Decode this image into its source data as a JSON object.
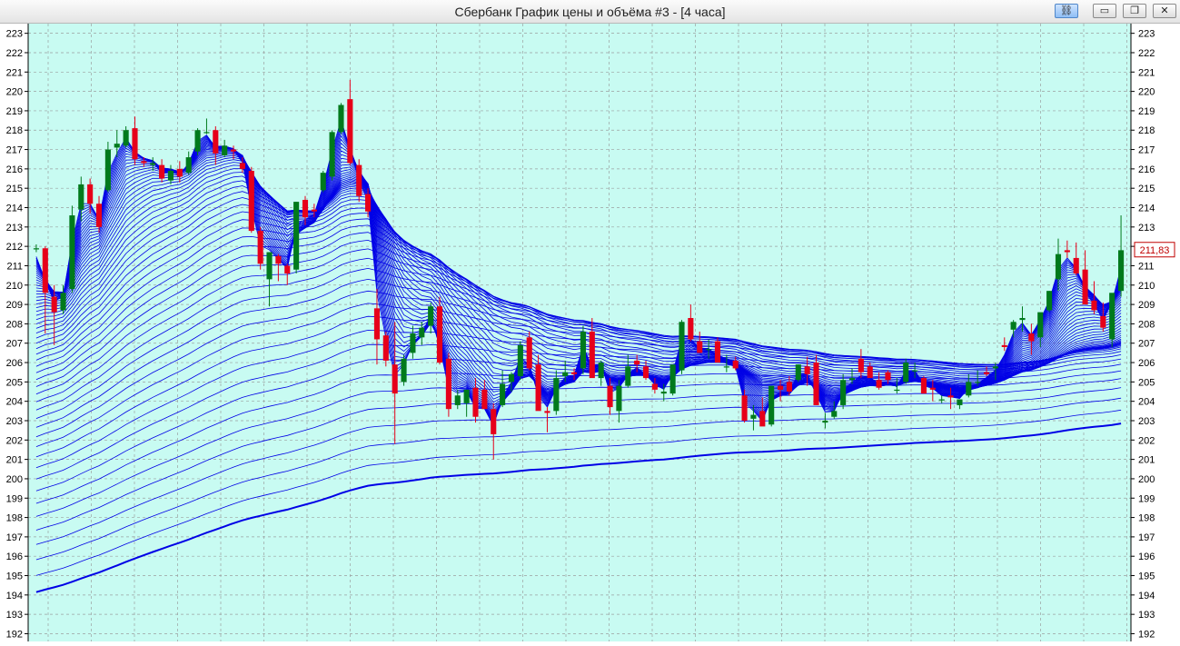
{
  "window": {
    "title": "Сбербанк График цены и объёма #3 - [4 часа]",
    "buttons": {
      "link": "⛓",
      "minimize": "▭",
      "restore": "❐",
      "close": "✕"
    }
  },
  "colors": {
    "background": "#c8fbf2",
    "grid": "#9aa0a0",
    "ma_lines": "#0000e6",
    "candle_up": "#007a1c",
    "candle_down": "#e6001a",
    "price_label": "#c00000"
  },
  "chart_data": {
    "type": "candlestick",
    "title": "Сбербанк График цены и объёма #3 - [4 часа]",
    "ylim": [
      191.6,
      223.5
    ],
    "yticks": [
      192,
      193,
      194,
      195,
      196,
      197,
      198,
      199,
      200,
      201,
      202,
      203,
      204,
      205,
      206,
      207,
      208,
      209,
      210,
      211,
      212,
      213,
      214,
      215,
      216,
      217,
      218,
      219,
      220,
      221,
      222,
      223
    ],
    "grid": true,
    "last_price_label": "211,83",
    "last_price": 211.83,
    "ma_ribbon": {
      "count": 55,
      "min_period": 2,
      "max_period": 240,
      "type": "ema"
    },
    "candles": [
      [
        211.9,
        212.1,
        211.7,
        211.9
      ],
      [
        211.9,
        212.0,
        207.5,
        209.6
      ],
      [
        209.4,
        210.0,
        206.9,
        208.6
      ],
      [
        208.7,
        210.0,
        208.5,
        209.6
      ],
      [
        209.8,
        214.1,
        209.6,
        213.6
      ],
      [
        213.9,
        215.6,
        213.3,
        215.2
      ],
      [
        215.2,
        215.5,
        213.7,
        214.2
      ],
      [
        214.2,
        214.6,
        212.7,
        213.0
      ],
      [
        214.9,
        217.4,
        214.8,
        217.0
      ],
      [
        217.1,
        218.0,
        216.6,
        217.3
      ],
      [
        217.2,
        218.2,
        217.1,
        218.0
      ],
      [
        218.1,
        218.7,
        216.2,
        216.5
      ],
      [
        216.4,
        216.6,
        216.1,
        216.3
      ],
      [
        216.2,
        216.6,
        215.9,
        216.3
      ],
      [
        216.2,
        216.5,
        215.3,
        215.5
      ],
      [
        215.4,
        216.2,
        215.2,
        215.9
      ],
      [
        216.0,
        216.4,
        215.3,
        215.6
      ],
      [
        215.8,
        216.9,
        215.7,
        216.6
      ],
      [
        216.9,
        218.1,
        216.7,
        218.0
      ],
      [
        217.9,
        218.6,
        217.8,
        217.9
      ],
      [
        218.0,
        218.2,
        216.2,
        216.8
      ],
      [
        216.7,
        217.5,
        216.6,
        217.2
      ],
      [
        217.0,
        217.2,
        216.5,
        216.9
      ],
      [
        216.3,
        216.6,
        215.8,
        216.0
      ],
      [
        215.9,
        216.1,
        212.7,
        212.8
      ],
      [
        212.8,
        213.0,
        210.8,
        211.1
      ],
      [
        210.3,
        211.7,
        208.9,
        211.7
      ],
      [
        211.5,
        211.6,
        210.2,
        211.1
      ],
      [
        211.0,
        211.1,
        210.0,
        210.6
      ],
      [
        210.8,
        214.3,
        210.6,
        214.3
      ],
      [
        214.4,
        214.6,
        213.1,
        213.5
      ],
      [
        213.9,
        214.2,
        213.5,
        213.8
      ],
      [
        214.9,
        215.9,
        214.8,
        215.8
      ],
      [
        215.6,
        218.0,
        215.4,
        217.9
      ],
      [
        217.9,
        219.4,
        217.8,
        219.3
      ],
      [
        219.6,
        220.6,
        216.2,
        216.3
      ],
      [
        216.2,
        216.5,
        214.3,
        214.6
      ],
      [
        214.7,
        215.0,
        213.5,
        213.8
      ],
      [
        208.8,
        209.8,
        205.9,
        207.2
      ],
      [
        207.4,
        207.6,
        205.8,
        206.1
      ],
      [
        205.9,
        208.1,
        201.8,
        204.4
      ],
      [
        205.0,
        206.4,
        204.8,
        206.2
      ],
      [
        206.5,
        207.9,
        206.2,
        207.5
      ],
      [
        207.3,
        208.1,
        206.9,
        207.8
      ],
      [
        207.9,
        209.1,
        207.5,
        208.9
      ],
      [
        208.9,
        209.4,
        205.9,
        206.0
      ],
      [
        206.2,
        206.5,
        203.2,
        203.6
      ],
      [
        203.8,
        204.6,
        203.6,
        204.3
      ],
      [
        203.9,
        204.6,
        203.2,
        204.6
      ],
      [
        204.7,
        205.2,
        202.9,
        203.2
      ],
      [
        204.6,
        205.1,
        203.7,
        203.6
      ],
      [
        203.6,
        203.9,
        201.0,
        202.3
      ],
      [
        203.8,
        205.6,
        203.7,
        204.9
      ],
      [
        205.0,
        205.5,
        204.5,
        205.4
      ],
      [
        205.3,
        207.1,
        205.1,
        206.9
      ],
      [
        207.3,
        207.6,
        205.6,
        205.7
      ],
      [
        205.9,
        206.4,
        203.9,
        203.5
      ],
      [
        203.5,
        203.7,
        202.4,
        203.4
      ],
      [
        203.5,
        205.6,
        203.3,
        205.2
      ],
      [
        205.3,
        206.1,
        205.0,
        205.5
      ],
      [
        205.5,
        205.7,
        205.1,
        205.4
      ],
      [
        205.7,
        207.9,
        205.4,
        207.6
      ],
      [
        207.6,
        208.3,
        205.3,
        205.2
      ],
      [
        205.2,
        206.1,
        204.8,
        206.0
      ],
      [
        204.8,
        205.2,
        203.3,
        203.7
      ],
      [
        203.5,
        205.1,
        202.9,
        204.8
      ],
      [
        204.8,
        206.4,
        204.7,
        205.8
      ],
      [
        206.1,
        206.4,
        205.5,
        205.9
      ],
      [
        205.8,
        206.1,
        205.1,
        205.2
      ],
      [
        204.9,
        205.2,
        204.4,
        204.6
      ],
      [
        204.4,
        204.9,
        204.0,
        204.5
      ],
      [
        204.4,
        205.9,
        204.3,
        205.9
      ],
      [
        205.6,
        208.2,
        205.4,
        208.1
      ],
      [
        208.3,
        209.0,
        207.1,
        207.2
      ],
      [
        207.1,
        207.6,
        206.5,
        206.5
      ],
      [
        206.7,
        207.2,
        206.2,
        206.7
      ],
      [
        207.1,
        207.3,
        206.0,
        206.0
      ],
      [
        205.8,
        206.4,
        205.5,
        205.8
      ],
      [
        206.1,
        206.3,
        205.6,
        205.7
      ],
      [
        204.3,
        204.6,
        202.9,
        203.0
      ],
      [
        203.1,
        203.8,
        202.5,
        203.3
      ],
      [
        203.5,
        204.2,
        202.8,
        202.7
      ],
      [
        202.8,
        204.7,
        202.7,
        204.8
      ],
      [
        204.8,
        205.1,
        204.0,
        204.6
      ],
      [
        205.0,
        205.3,
        204.3,
        204.5
      ],
      [
        205.1,
        205.9,
        205.0,
        205.9
      ],
      [
        205.8,
        206.3,
        204.8,
        205.4
      ],
      [
        206.0,
        206.4,
        203.8,
        203.8
      ],
      [
        202.9,
        203.4,
        202.6,
        203.0
      ],
      [
        203.2,
        204.0,
        203.1,
        203.5
      ],
      [
        203.8,
        205.4,
        203.6,
        205.1
      ],
      [
        205.1,
        205.7,
        204.9,
        205.2
      ],
      [
        206.2,
        206.7,
        205.2,
        205.5
      ],
      [
        205.8,
        206.0,
        205.2,
        205.2
      ],
      [
        205.1,
        205.5,
        204.6,
        204.7
      ],
      [
        205.5,
        205.6,
        204.9,
        205.1
      ],
      [
        204.6,
        205.2,
        204.4,
        204.6
      ],
      [
        205.0,
        206.2,
        204.9,
        206.0
      ],
      [
        205.6,
        206.0,
        205.2,
        205.6
      ],
      [
        205.2,
        205.3,
        204.4,
        204.4
      ],
      [
        204.7,
        205.1,
        204.0,
        204.6
      ],
      [
        204.1,
        204.3,
        203.9,
        204.1
      ],
      [
        204.3,
        204.7,
        203.6,
        204.2
      ],
      [
        203.8,
        204.1,
        203.6,
        204.1
      ],
      [
        204.3,
        205.4,
        204.2,
        205.0
      ],
      [
        205.0,
        205.6,
        204.8,
        205.0
      ],
      [
        205.5,
        205.8,
        205.3,
        205.4
      ],
      [
        205.7,
        206.0,
        205.1,
        205.8
      ],
      [
        206.9,
        207.3,
        206.6,
        206.8
      ],
      [
        207.7,
        208.2,
        207.3,
        208.1
      ],
      [
        208.2,
        208.9,
        207.6,
        208.3
      ],
      [
        207.5,
        208.0,
        206.4,
        207.1
      ],
      [
        207.3,
        208.5,
        206.8,
        208.6
      ],
      [
        208.7,
        209.7,
        208.6,
        209.7
      ],
      [
        210.3,
        212.4,
        209.7,
        211.6
      ],
      [
        211.8,
        212.3,
        211.4,
        211.7
      ],
      [
        211.4,
        212.2,
        210.5,
        210.6
      ],
      [
        210.8,
        211.8,
        209.9,
        209.0
      ],
      [
        209.2,
        210.2,
        208.5,
        208.7
      ],
      [
        208.4,
        209.1,
        207.6,
        207.8
      ],
      [
        207.2,
        208.9,
        206.8,
        209.6
      ],
      [
        209.7,
        213.6,
        209.4,
        211.8
      ]
    ]
  }
}
